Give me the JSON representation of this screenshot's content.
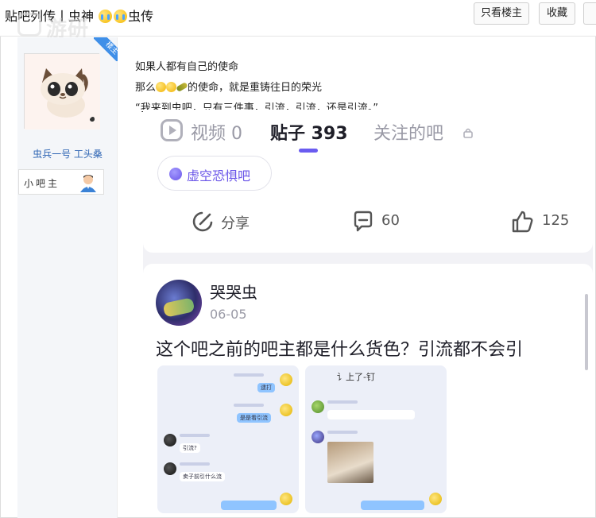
{
  "header": {
    "title_prefix": "贴吧列传丨虫神",
    "title_suffix": "虫传",
    "only_author_label": "只看楼主",
    "favorite_label": "收藏"
  },
  "watermark": {
    "text": "游研社"
  },
  "author": {
    "badge": "楼主",
    "name": "虫兵一号 工头桑",
    "role": "小吧主"
  },
  "post": {
    "line1": "如果人都有自己的使命",
    "line2_prefix": "那么",
    "line2_suffix": "的使命，就是重铸往日的荣光",
    "line3": "“我来到虫吧，只有三件事，引流，引流，还是引流。”"
  },
  "app": {
    "tabs": [
      {
        "label": "视频 0"
      },
      {
        "label": "贴子 393"
      },
      {
        "label": "关注的吧"
      }
    ],
    "forum_chip": "虚空恐惧吧",
    "actions": {
      "share": "分享",
      "comments": "60",
      "likes": "125"
    },
    "post": {
      "username": "哭哭虫",
      "date": "06-05",
      "title": "这个吧之前的吧主都是什么货色？引流都不会引",
      "chat_left": [
        "逮打",
        "是是看引流",
        "引流?",
        "卖子前引什么流"
      ],
      "chat_right_heading": "讠上了-钉"
    },
    "colors": {
      "accent": "#6a55e8",
      "badge": "#3f8fe8",
      "link": "#2d64b3"
    }
  }
}
